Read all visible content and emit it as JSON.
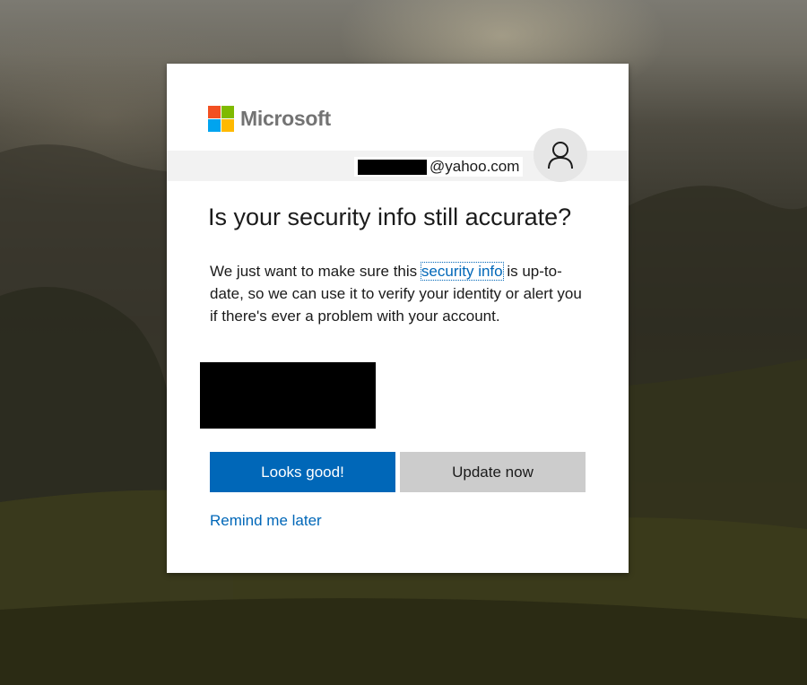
{
  "brand": {
    "name": "Microsoft",
    "colors": {
      "red": "#f25022",
      "green": "#7fba00",
      "blue": "#00a4ef",
      "yellow": "#ffb900",
      "accent": "#0067b8"
    }
  },
  "account": {
    "email_domain": "@yahoo.com",
    "avatar_icon": "user-icon"
  },
  "dialog": {
    "title": "Is your security info still accurate?",
    "description_before": "We just want to make sure this ",
    "description_link": "security info",
    "description_after": " is up-to-date, so we can use it to verify your identity or alert you if there's ever a problem with your account."
  },
  "actions": {
    "primary_label": "Looks good!",
    "secondary_label": "Update now",
    "remind_label": "Remind me later"
  }
}
